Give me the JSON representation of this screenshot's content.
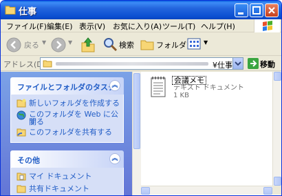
{
  "window": {
    "title": "仕事"
  },
  "menu": [
    "ファイル(F)",
    "編集(E)",
    "表示(V)",
    "お気に入り(A)",
    "ツール(T)",
    "ヘルプ(H)"
  ],
  "toolbar": {
    "back_label": "戻る",
    "search_label": "検索",
    "folders_label": "フォルダ"
  },
  "address": {
    "label": "アドレス(D)",
    "value_suffix": "¥仕事",
    "go_label": "移動"
  },
  "tasks": {
    "header": "ファイルとフォルダのタスク",
    "items": [
      "新しいフォルダを作成する",
      "このフォルダを Web に公開",
      "する",
      "このフォルダを共有する"
    ]
  },
  "other": {
    "header": "その他",
    "items": [
      "マイ ドキュメント",
      "共有ドキュメント"
    ]
  },
  "file": {
    "name": "会議メモ",
    "type": "テキスト ドキュメント",
    "size": "1 KB"
  },
  "colors": {
    "title_bar": "#2466de",
    "task_link": "#215dc6",
    "pane_bg": "#7ba2e7"
  }
}
